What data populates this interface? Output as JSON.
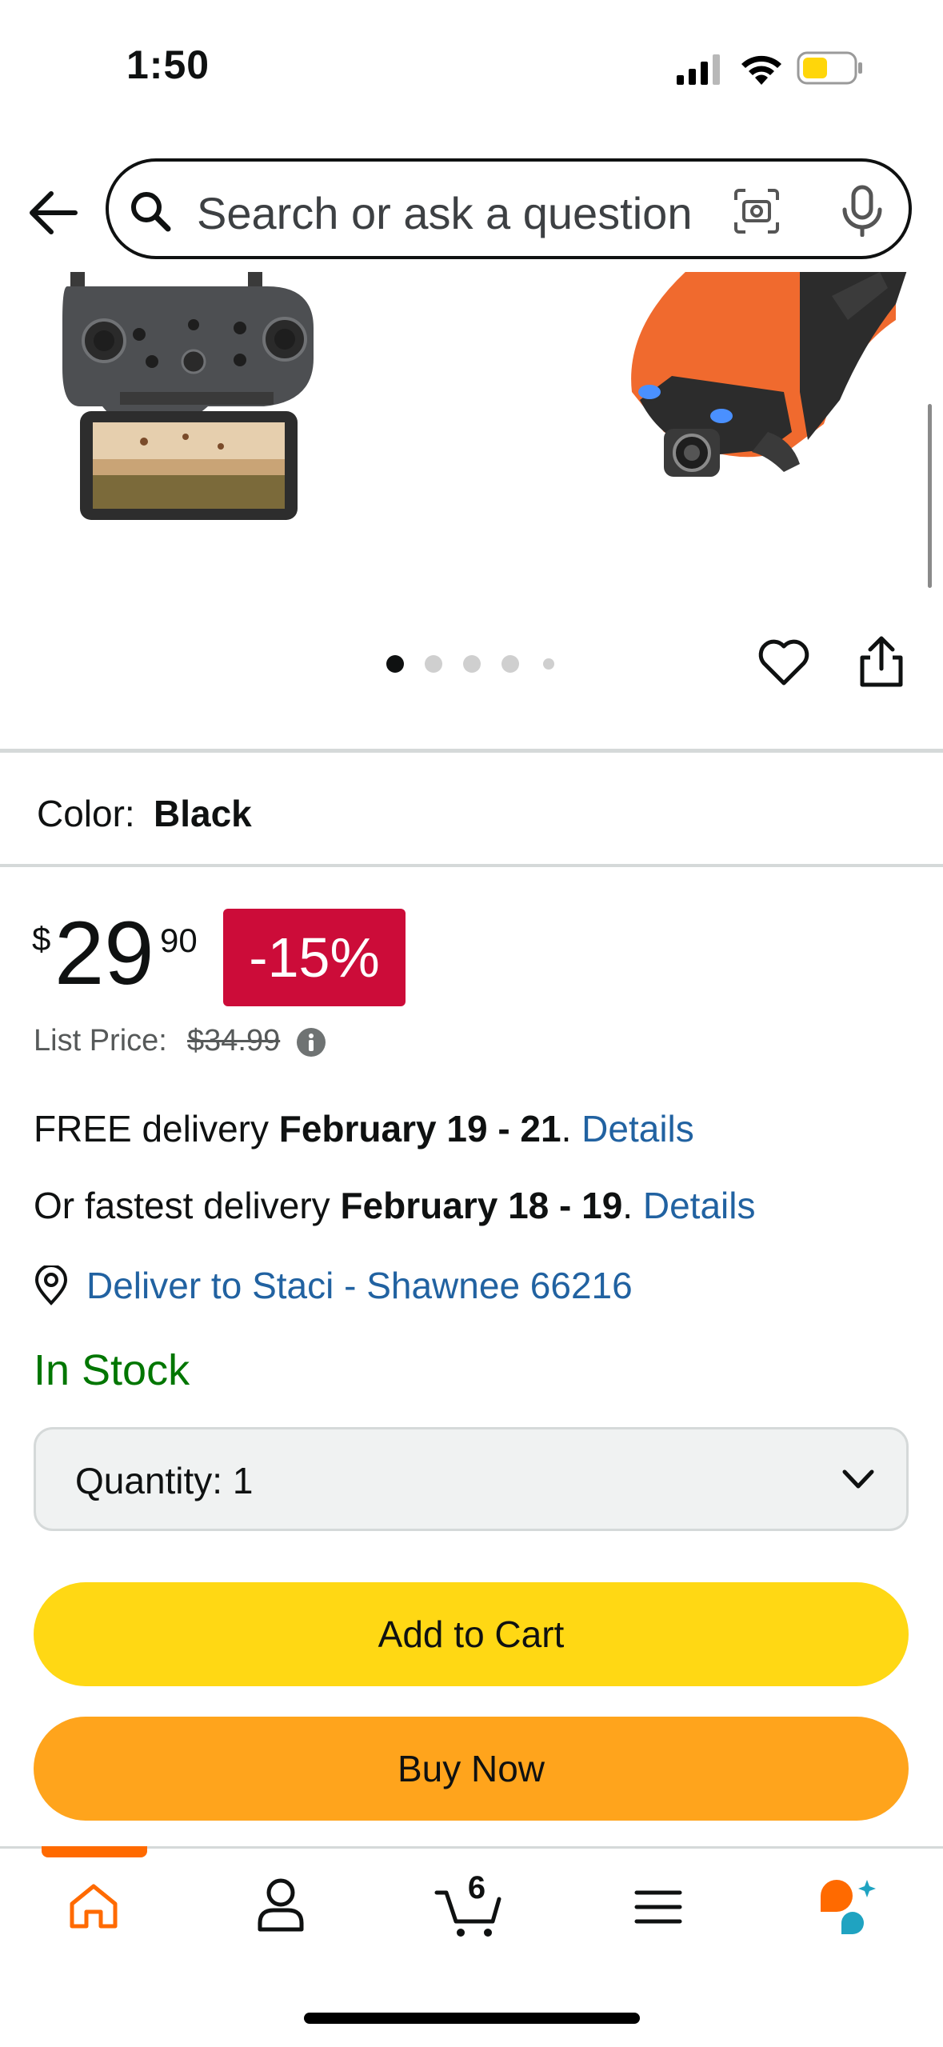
{
  "status_bar": {
    "time": "1:50"
  },
  "search": {
    "placeholder": "Search or ask a question"
  },
  "gallery": {
    "image_count": 5,
    "active_index": 0
  },
  "product": {
    "color_label": "Color:",
    "color_value": "Black",
    "price_currency": "$",
    "price_whole": "29",
    "price_fraction": "90",
    "discount": "-15%",
    "list_price_label": "List Price:",
    "list_price_value": "$34.99"
  },
  "delivery": {
    "free_prefix": "FREE delivery ",
    "free_dates": "February 19 - 21",
    "free_sep": ". ",
    "free_link": "Details",
    "fast_prefix": "Or fastest delivery ",
    "fast_dates": "February 18 - 19",
    "fast_sep": ". ",
    "fast_link": "Details",
    "deliver_to": "Deliver to Staci - Shawnee 66216"
  },
  "stock_status": "In Stock",
  "quantity": {
    "label": "Quantity:",
    "value": "1"
  },
  "buttons": {
    "add_to_cart": "Add to Cart",
    "buy_now": "Buy Now"
  },
  "bottom_nav": {
    "items": [
      "home-icon",
      "account-icon",
      "cart-icon",
      "menu-icon",
      "rufus-icon"
    ],
    "active": "home",
    "cart_count": "6"
  },
  "colors": {
    "discount_badge": "#CC0C39",
    "add_to_cart": "#FFD814",
    "buy_now": "#FFA41C",
    "link": "#2162A1",
    "in_stock": "#007600",
    "nav_active": "#FF6A00"
  }
}
